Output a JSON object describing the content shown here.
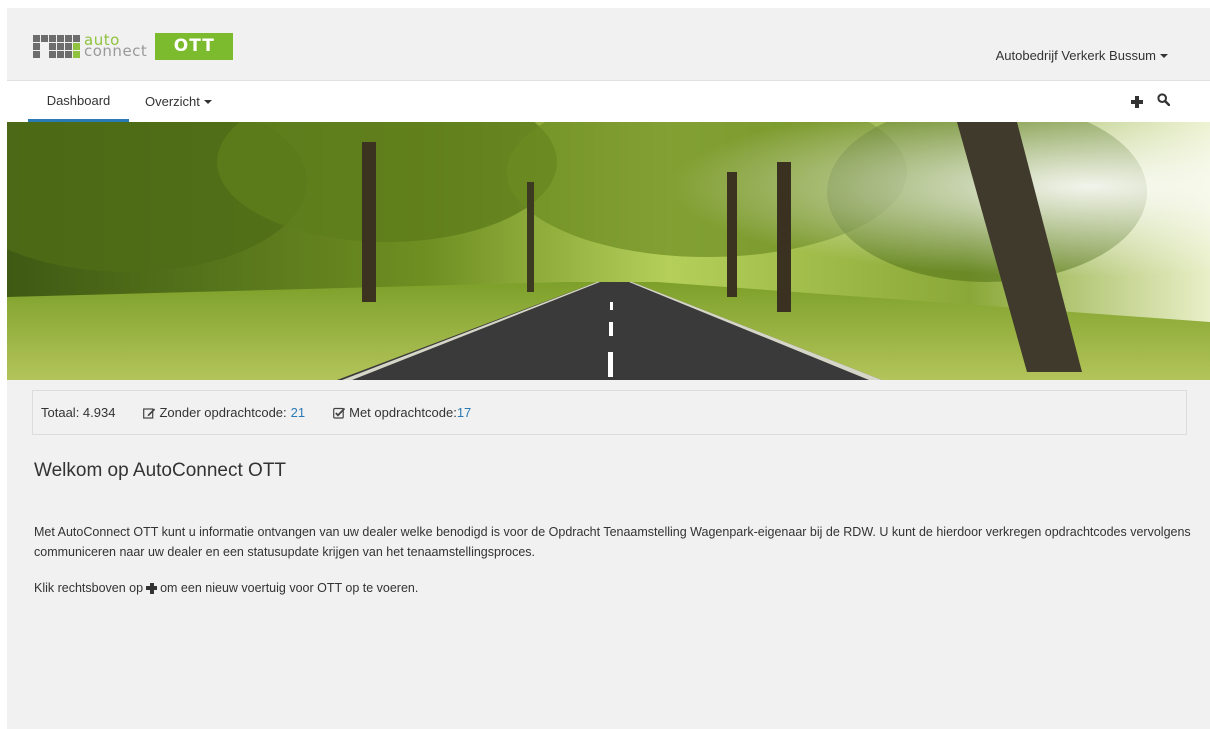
{
  "brand": {
    "logo_line1": "auto",
    "logo_line2": "connect",
    "logo_badge": "OTT",
    "colors": {
      "accent_green": "#7dbb2e",
      "link_blue": "#2a7ab5"
    }
  },
  "header": {
    "user_menu_label": "Autobedrijf Verkerk Bussum"
  },
  "nav": {
    "dashboard_label": "Dashboard",
    "overzicht_label": "Overzicht",
    "add_icon": "plus-icon",
    "search_icon": "search-icon"
  },
  "stats": {
    "total_label": "Totaal: 4.934",
    "without_code_label": "Zonder opdrachtcode:",
    "without_code_count": "21",
    "with_code_label": "Met opdrachtcode:",
    "with_code_count": "17"
  },
  "content": {
    "title": "Welkom op AutoConnect OTT",
    "paragraph": "Met AutoConnect OTT kunt u informatie ontvangen van uw dealer welke benodigd is voor de Opdracht Tenaamstelling Wagenpark-eigenaar bij de RDW. U kunt de hierdoor verkregen opdrachtcodes vervolgens communiceren naar uw dealer en een statusupdate krijgen van het tenaamstellingsproces.",
    "instruction_before": "Klik rechtsboven op",
    "instruction_after": "om een nieuw voertuig voor OTT op te voeren."
  }
}
